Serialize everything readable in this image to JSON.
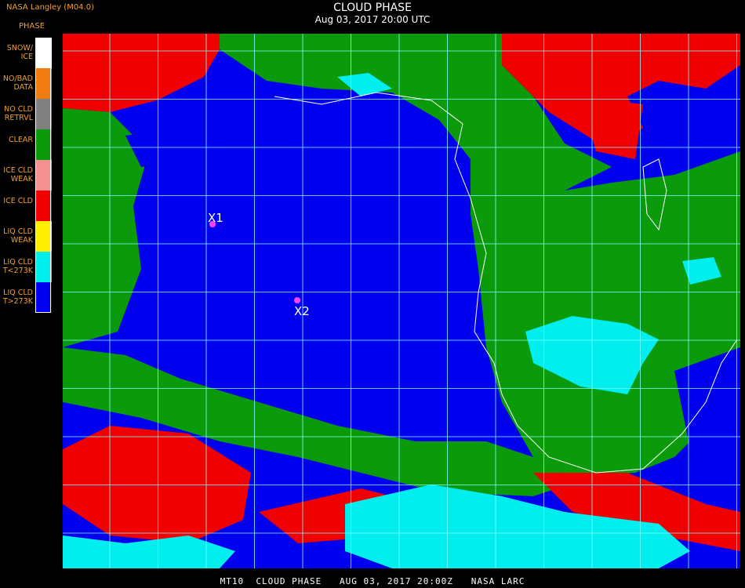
{
  "header": {
    "source": "NASA Langley (M04.0)",
    "legend_title": "PHASE",
    "title": "CLOUD PHASE",
    "subtitle": "Aug 03, 2017 20:00 UTC"
  },
  "legend": [
    {
      "label": "SNOW/\nICE",
      "color": "#ffffff"
    },
    {
      "label": "NO/BAD\nDATA",
      "color": "#f07c10"
    },
    {
      "label": "NO CLD\nRETRVL",
      "color": "#808080"
    },
    {
      "label": "CLEAR",
      "color": "#0a9a0a"
    },
    {
      "label": "ICE CLD\nWEAK",
      "color": "#f49090"
    },
    {
      "label": "ICE CLD",
      "color": "#f00000"
    },
    {
      "label": "LIQ CLD\nWEAK",
      "color": "#ffee00"
    },
    {
      "label": "LIQ CLD\nT<273K",
      "color": "#00eeee"
    },
    {
      "label": "LIQ CLD\nT>273K",
      "color": "#0000ee"
    }
  ],
  "markers": [
    {
      "label": "X1"
    },
    {
      "label": "X2"
    }
  ],
  "footer": "MT10  CLOUD PHASE   AUG 03, 2017 20:00Z   NASA LARC",
  "colors": {
    "clear": "#0a9a0a",
    "liq_warm": "#0000ee",
    "liq_cold": "#00eeee",
    "ice": "#f00000",
    "grid": "#7fffff",
    "coast": "#ffffff",
    "marker": "#ff40ff"
  }
}
